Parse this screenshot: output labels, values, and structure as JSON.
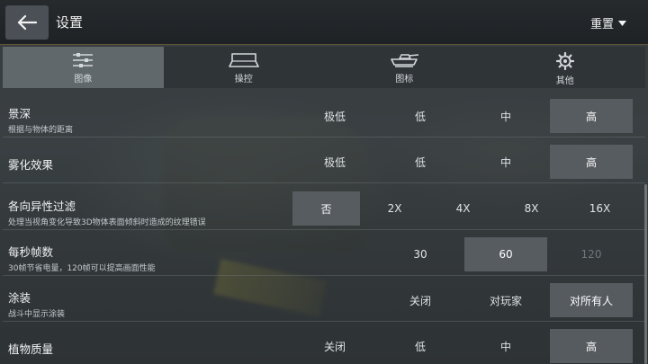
{
  "header": {
    "title": "设置",
    "reset_label": "重置"
  },
  "tabs": [
    {
      "label": "图像",
      "icon": "sliders-icon",
      "active": true
    },
    {
      "label": "操控",
      "icon": "gamepad-icon",
      "active": false
    },
    {
      "label": "图标",
      "icon": "tank-icon",
      "active": false
    },
    {
      "label": "其他",
      "icon": "gear-icon",
      "active": false
    }
  ],
  "rows": [
    {
      "title": "景深",
      "subtitle": "根据与物体的距离",
      "options": [
        {
          "label": "极低",
          "state": "normal"
        },
        {
          "label": "低",
          "state": "normal"
        },
        {
          "label": "中",
          "state": "normal"
        },
        {
          "label": "高",
          "state": "selected"
        }
      ]
    },
    {
      "title": "雾化效果",
      "subtitle": "",
      "options": [
        {
          "label": "极低",
          "state": "normal"
        },
        {
          "label": "低",
          "state": "normal"
        },
        {
          "label": "中",
          "state": "normal"
        },
        {
          "label": "高",
          "state": "selected"
        }
      ]
    },
    {
      "title": "各向异性过滤",
      "subtitle": "处理当视角变化导致3D物体表面倾斜时造成的纹理错误",
      "options": [
        {
          "label": "否",
          "state": "selected"
        },
        {
          "label": "2X",
          "state": "normal"
        },
        {
          "label": "4X",
          "state": "normal"
        },
        {
          "label": "8X",
          "state": "normal"
        },
        {
          "label": "16X",
          "state": "normal"
        }
      ]
    },
    {
      "title": "每秒帧数",
      "subtitle": "30帧节省电量，120帧可以提高画面性能",
      "options": [
        {
          "label": "30",
          "state": "normal"
        },
        {
          "label": "60",
          "state": "selected"
        },
        {
          "label": "120",
          "state": "disabled"
        }
      ]
    },
    {
      "title": "涂装",
      "subtitle": "战斗中显示涂装",
      "options": [
        {
          "label": "关闭",
          "state": "normal"
        },
        {
          "label": "对玩家",
          "state": "normal"
        },
        {
          "label": "对所有人",
          "state": "selected"
        }
      ]
    },
    {
      "title": "植物质量",
      "subtitle": "",
      "options": [
        {
          "label": "关闭",
          "state": "normal"
        },
        {
          "label": "低",
          "state": "normal"
        },
        {
          "label": "中",
          "state": "normal"
        },
        {
          "label": "高",
          "state": "selected"
        }
      ]
    }
  ]
}
